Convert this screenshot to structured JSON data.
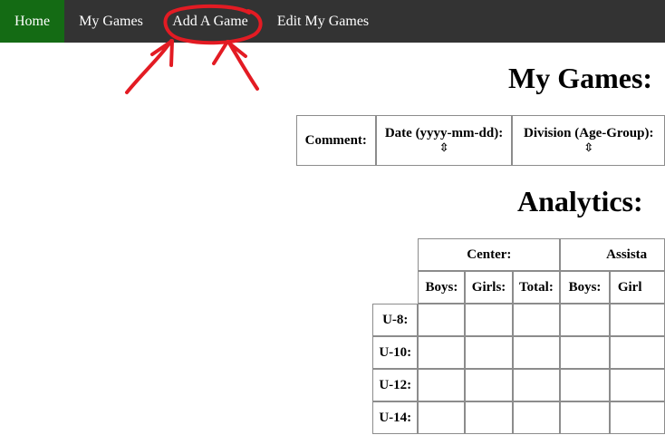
{
  "nav": {
    "items": [
      {
        "label": "Home"
      },
      {
        "label": "My Games"
      },
      {
        "label": "Add A Game"
      },
      {
        "label": "Edit My Games"
      }
    ],
    "active_color": "#146b14",
    "bar_color": "#333333"
  },
  "games": {
    "title": "My Games:",
    "columns": {
      "comment": "Comment:",
      "date": "Date (yyyy-mm-dd):",
      "division": "Division (Age-Group):"
    },
    "sort_icon": "⇳"
  },
  "analytics": {
    "title": "Analytics:",
    "groups": {
      "center": "Center:",
      "assistant": "Assista"
    },
    "sub": {
      "boys": "Boys:",
      "girls": "Girls:",
      "total": "Total:",
      "girls_cut": "Girl"
    },
    "rows": [
      "U-8:",
      "U-10:",
      "U-12:",
      "U-14:"
    ]
  },
  "annotation": {
    "color": "#e31b23"
  }
}
